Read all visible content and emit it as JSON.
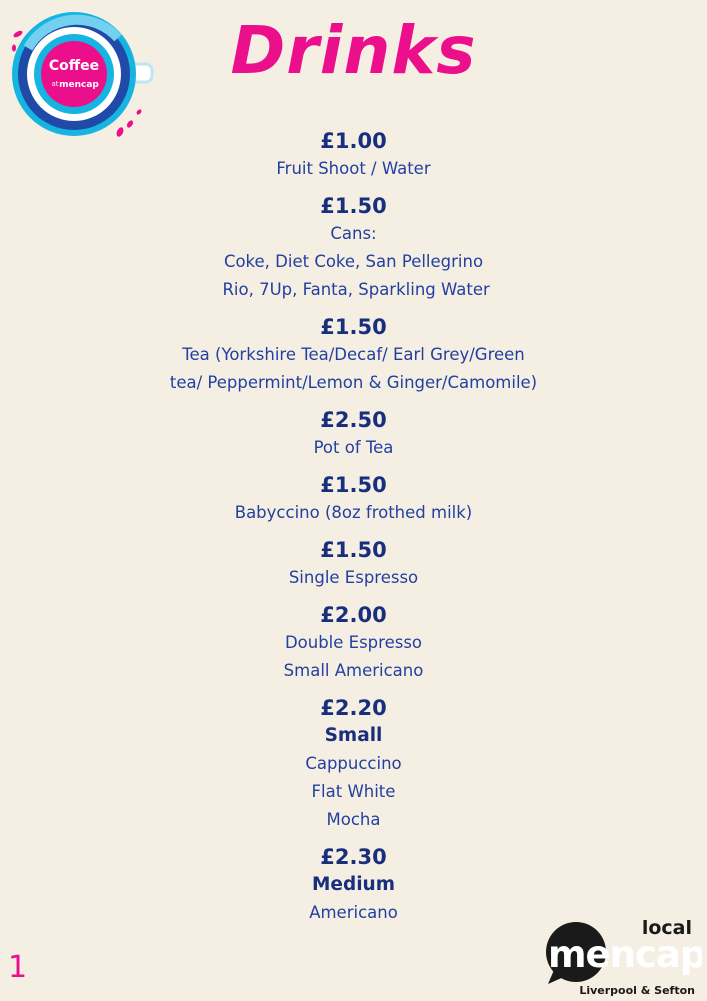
{
  "logo": {
    "text_top": "Coffee",
    "text_at": "at",
    "text_brand": "mencap",
    "icon": "coffee-cup-logo"
  },
  "title": "Drinks",
  "sections": [
    {
      "price": "£1.00",
      "lines": [
        "Fruit Shoot / Water"
      ]
    },
    {
      "price": "£1.50",
      "lines": [
        "Cans:",
        "Coke, Diet Coke, San Pellegrino",
        " Rio, 7Up, Fanta, Sparkling Water"
      ]
    },
    {
      "price": "£1.50",
      "lines": [
        "Tea (Yorkshire Tea/Decaf/ Earl Grey/Green",
        "tea/ Peppermint/Lemon & Ginger/Camomile)"
      ]
    },
    {
      "price": "£2.50",
      "lines": [
        "Pot of Tea"
      ]
    },
    {
      "price": "£1.50",
      "lines": [
        "Babyccino (8oz frothed milk)"
      ]
    },
    {
      "price": "£1.50",
      "lines": [
        "Single Espresso"
      ]
    },
    {
      "price": "£2.00",
      "lines": [
        "Double Espresso",
        "Small Americano"
      ]
    },
    {
      "price": "£2.20",
      "subheading": "Small",
      "lines": [
        "Cappuccino",
        "Flat White",
        "Mocha"
      ]
    },
    {
      "price": "£2.30",
      "subheading": "Medium",
      "lines": [
        "Americano"
      ]
    }
  ],
  "page_number": "1",
  "footer_logo": {
    "local": "local",
    "brand": "mencap",
    "region": "Liverpool & Sefton"
  },
  "colors": {
    "background": "#f5efe3",
    "accent_pink": "#ec0f8c",
    "navy": "#182f7e",
    "cyan": "#16b4e0"
  }
}
